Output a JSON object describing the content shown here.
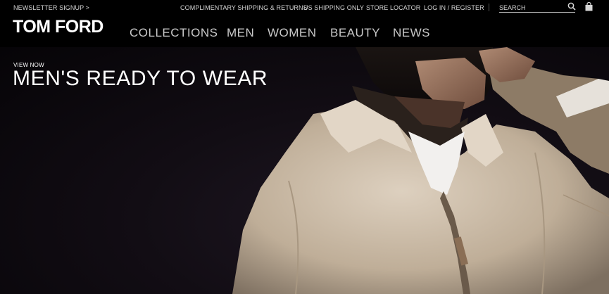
{
  "topbar": {
    "newsletter": "NEWSLETTER SIGNUP >",
    "links": [
      "COMPLIMENTARY SHIPPING & RETURNS",
      "US SHIPPING ONLY",
      "STORE LOCATOR",
      "LOG IN / REGISTER"
    ],
    "search": {
      "placeholder": "SEARCH",
      "icon": "magnifier-glyph"
    },
    "bag_icon": "shopping-bag-glyph"
  },
  "header": {
    "logo": "TOM FORD",
    "nav": [
      "COLLECTIONS",
      "MEN",
      "WOMEN",
      "BEAUTY",
      "NEWS"
    ]
  },
  "hero": {
    "kicker": "VIEW NOW",
    "title": "MEN'S READY TO WEAR"
  },
  "colors": {
    "background": "#000000",
    "nav_text": "#c9c9c9",
    "jacket": "#d2c3b0"
  }
}
